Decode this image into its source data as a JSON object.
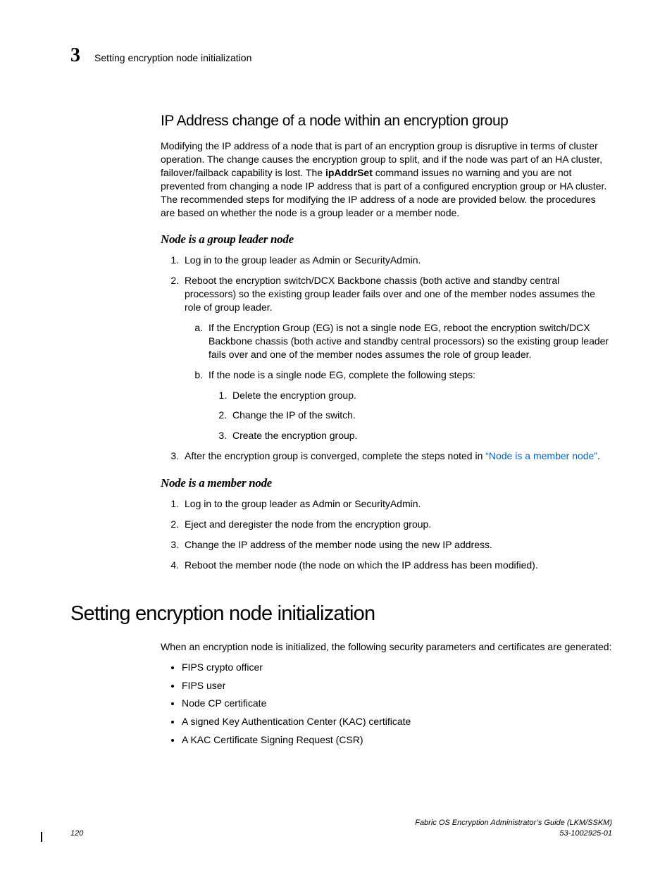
{
  "header": {
    "chapter_number": "3",
    "running_title": "Setting encryption node initialization"
  },
  "section1": {
    "title": "IP Address change of a node within an encryption group",
    "intro_a": "Modifying the IP address of a node that is part of an encryption group is disruptive in terms of cluster operation. The change causes the encryption group to split, and if the node was part of an HA cluster, failover/failback capability is lost. The ",
    "intro_cmd": "ipAddrSet",
    "intro_b": " command issues no warning and you are not prevented from changing a node IP address that is part of a configured encryption group or HA cluster. The recommended steps for modifying the IP address of a node are provided below. the procedures are based on whether the node is a group leader or a member node.",
    "sub1": {
      "title": "Node is a group leader node",
      "step1": "Log in to the group leader as Admin or SecurityAdmin.",
      "step2": "Reboot the encryption switch/DCX Backbone chassis (both active and standby central processors) so the existing group leader fails over and one of the member nodes assumes the role of group leader.",
      "step2a": "If the Encryption Group (EG) is not a single node EG, reboot the encryption switch/DCX Backbone chassis (both active and standby central processors) so the existing group leader fails over and one of the member nodes assumes the role of group leader.",
      "step2b": "If the node is a single node EG, complete the following steps:",
      "step2b1": "Delete the encryption group.",
      "step2b2": "Change the IP of the switch.",
      "step2b3": "Create the encryption group.",
      "step3_a": "After the encryption group is converged, complete the steps noted in ",
      "step3_link": "“Node is a member node”",
      "step3_b": "."
    },
    "sub2": {
      "title": "Node is a member node",
      "step1": "Log in to the group leader as Admin or SecurityAdmin.",
      "step2": "Eject and deregister the node from the encryption group.",
      "step3": "Change the IP address of the member node using the new IP address.",
      "step4": "Reboot the member node (the node on which the IP address has been modified)."
    }
  },
  "section2": {
    "title": "Setting encryption node initialization",
    "intro": "When an encryption node is initialized, the following security parameters and certificates are generated:",
    "bullets": {
      "b1": "FIPS crypto officer",
      "b2": "FIPS user",
      "b3": "Node CP certificate",
      "b4": "A signed Key Authentication Center (KAC) certificate",
      "b5": "A KAC Certificate Signing Request (CSR)"
    }
  },
  "footer": {
    "page": "120",
    "doc_title": "Fabric OS Encryption Administrator’s Guide  (LKM/SSKM)",
    "doc_num": "53-1002925-01"
  }
}
